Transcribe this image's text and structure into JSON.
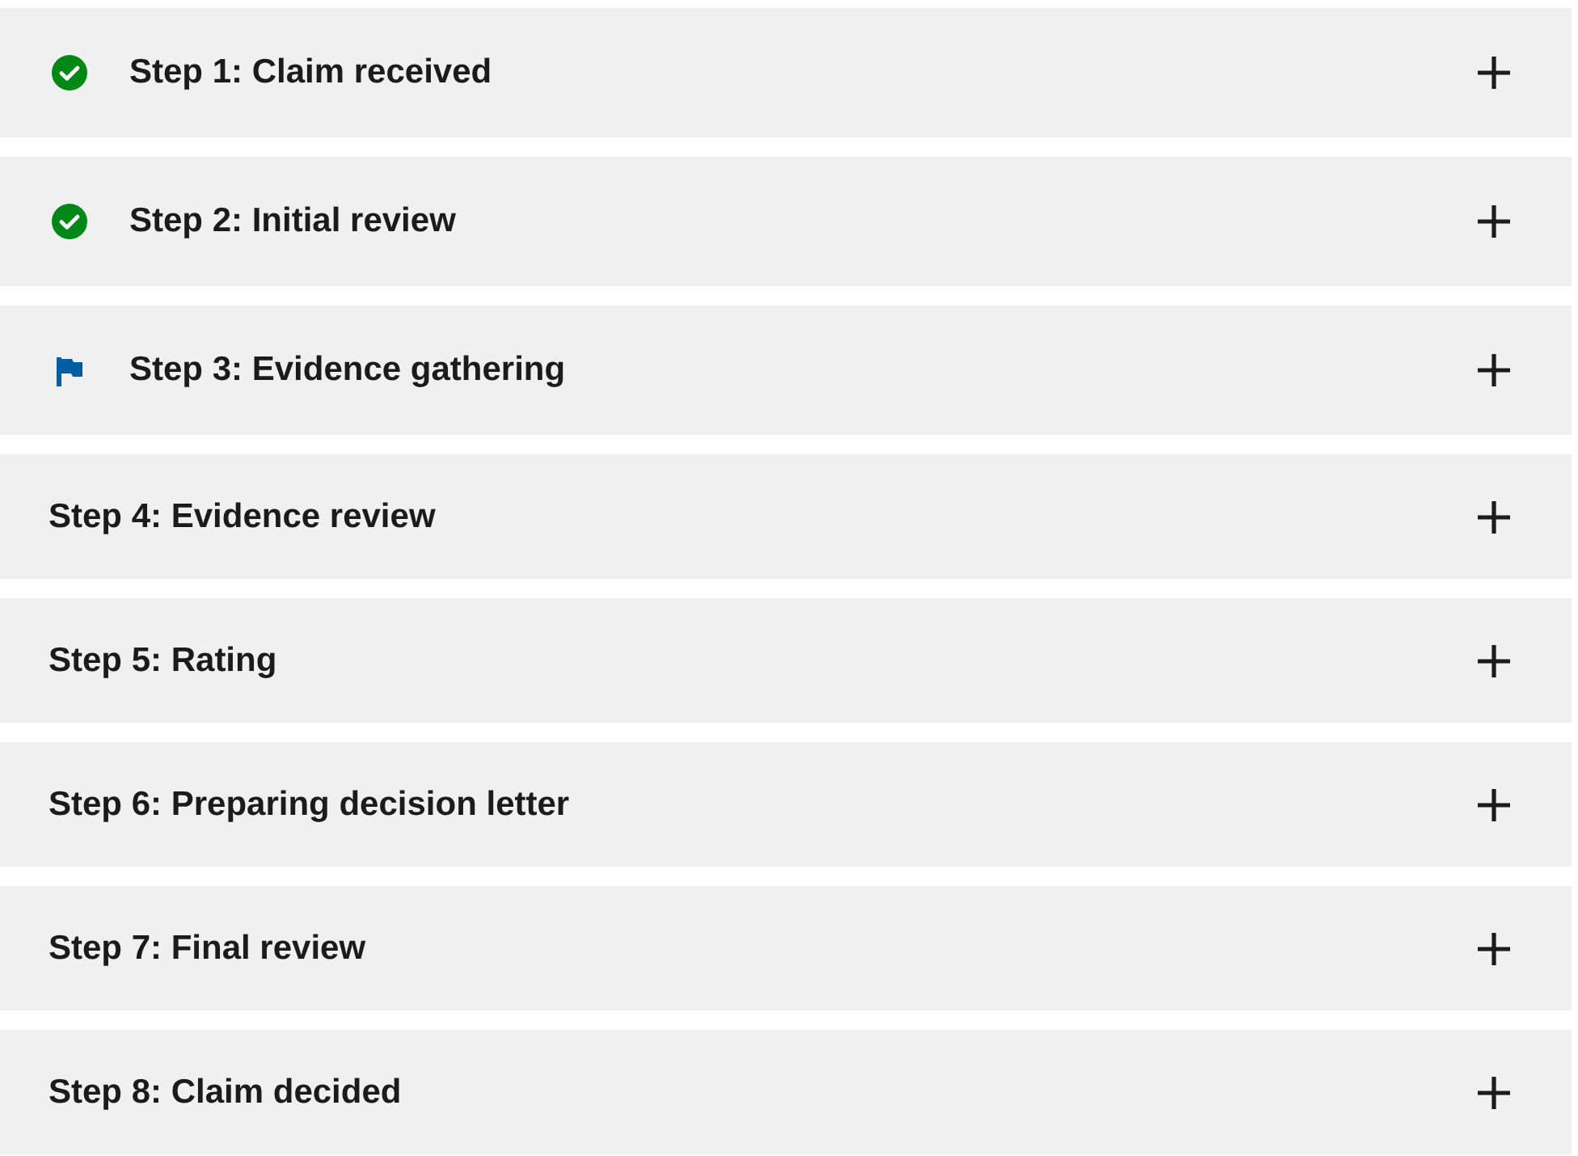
{
  "steps": [
    {
      "title": "Step 1: Claim received",
      "kind": "complete",
      "expanded": false
    },
    {
      "title": "Step 2: Initial review",
      "kind": "complete",
      "expanded": false
    },
    {
      "title": "Step 3: Evidence gathering",
      "kind": "current",
      "expanded": false
    },
    {
      "title": "Step 4: Evidence review",
      "kind": "upcoming",
      "expanded": false
    },
    {
      "title": "Step 5: Rating",
      "kind": "upcoming",
      "expanded": false
    },
    {
      "title": "Step 6: Preparing decision letter",
      "kind": "upcoming",
      "expanded": false
    },
    {
      "title": "Step 7: Final review",
      "kind": "upcoming",
      "expanded": false
    },
    {
      "title": "Step 8: Claim decided",
      "kind": "upcoming",
      "expanded": false
    }
  ]
}
